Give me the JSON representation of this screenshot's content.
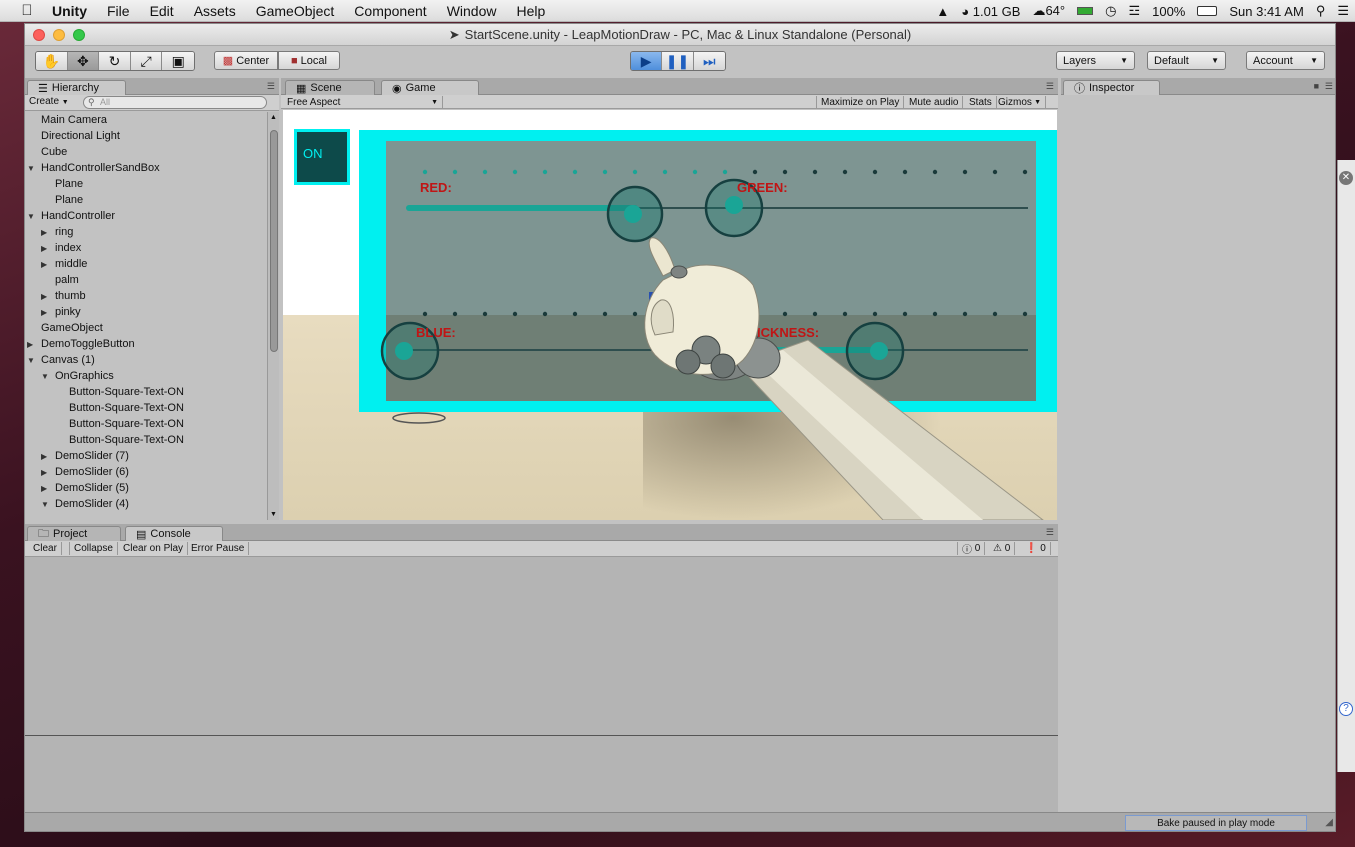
{
  "menubar": {
    "items": [
      "Unity",
      "File",
      "Edit",
      "Assets",
      "GameObject",
      "Component",
      "Window",
      "Help"
    ],
    "status": {
      "memory": "1.01 GB",
      "weather": "64°",
      "battery": "100%",
      "clock": "Sun 3:41 AM"
    }
  },
  "window": {
    "title": "StartScene.unity - LeapMotionDraw - PC, Mac & Linux Standalone (Personal)"
  },
  "toolbar": {
    "pivot_label": "Center",
    "space_label": "Local",
    "layers_label": "Layers",
    "layout_label": "Default",
    "account_label": "Account"
  },
  "hierarchy": {
    "tab": "Hierarchy",
    "create_label": "Create",
    "search_placeholder": "All",
    "items": [
      {
        "label": "Main Camera",
        "indent": 0,
        "arrow": ""
      },
      {
        "label": "Directional Light",
        "indent": 0,
        "arrow": ""
      },
      {
        "label": "Cube",
        "indent": 0,
        "arrow": ""
      },
      {
        "label": "HandControllerSandBox",
        "indent": 0,
        "arrow": "open"
      },
      {
        "label": "Plane",
        "indent": 1,
        "arrow": ""
      },
      {
        "label": "Plane",
        "indent": 1,
        "arrow": ""
      },
      {
        "label": "HandController",
        "indent": 0,
        "arrow": "open"
      },
      {
        "label": "ring",
        "indent": 1,
        "arrow": "closed"
      },
      {
        "label": "index",
        "indent": 1,
        "arrow": "closed"
      },
      {
        "label": "middle",
        "indent": 1,
        "arrow": "closed"
      },
      {
        "label": "palm",
        "indent": 1,
        "arrow": ""
      },
      {
        "label": "thumb",
        "indent": 1,
        "arrow": "closed"
      },
      {
        "label": "pinky",
        "indent": 1,
        "arrow": "closed"
      },
      {
        "label": "GameObject",
        "indent": 0,
        "arrow": ""
      },
      {
        "label": "DemoToggleButton",
        "indent": 0,
        "arrow": "closed"
      },
      {
        "label": "Canvas (1)",
        "indent": 0,
        "arrow": "open"
      },
      {
        "label": "OnGraphics",
        "indent": 1,
        "arrow": "open"
      },
      {
        "label": "Button-Square-Text-ON",
        "indent": 2,
        "arrow": ""
      },
      {
        "label": "Button-Square-Text-ON",
        "indent": 2,
        "arrow": ""
      },
      {
        "label": "Button-Square-Text-ON",
        "indent": 2,
        "arrow": ""
      },
      {
        "label": "Button-Square-Text-ON",
        "indent": 2,
        "arrow": ""
      },
      {
        "label": "DemoSlider (7)",
        "indent": 1,
        "arrow": "closed"
      },
      {
        "label": "DemoSlider (6)",
        "indent": 1,
        "arrow": "closed"
      },
      {
        "label": "DemoSlider (5)",
        "indent": 1,
        "arrow": "closed"
      },
      {
        "label": "DemoSlider (4)",
        "indent": 1,
        "arrow": "open"
      }
    ]
  },
  "scene_tabs": {
    "scene": "Scene",
    "game": "Game"
  },
  "game_bar": {
    "aspect": "Free Aspect",
    "maximize": "Maximize on Play",
    "mute": "Mute audio",
    "stats": "Stats",
    "gizmos": "Gizmos"
  },
  "game_view": {
    "toggle_label": "ON",
    "slider_labels": {
      "red": "RED:",
      "green": "GREEN:",
      "blue": "BLUE:",
      "thickness": "ICKNESS:"
    }
  },
  "inspector": {
    "tab": "Inspector"
  },
  "console": {
    "project_tab": "Project",
    "console_tab": "Console",
    "buttons": [
      "Clear",
      "Collapse",
      "Clear on Play",
      "Error Pause"
    ],
    "counts": {
      "info": "0",
      "warnings": "0",
      "errors": "0"
    }
  },
  "statusbar": {
    "message": "Bake paused in play mode"
  },
  "colors": {
    "accent_cyan": "#00f0f0",
    "slider_teal": "#1aa596",
    "label_red": "#c01515"
  }
}
